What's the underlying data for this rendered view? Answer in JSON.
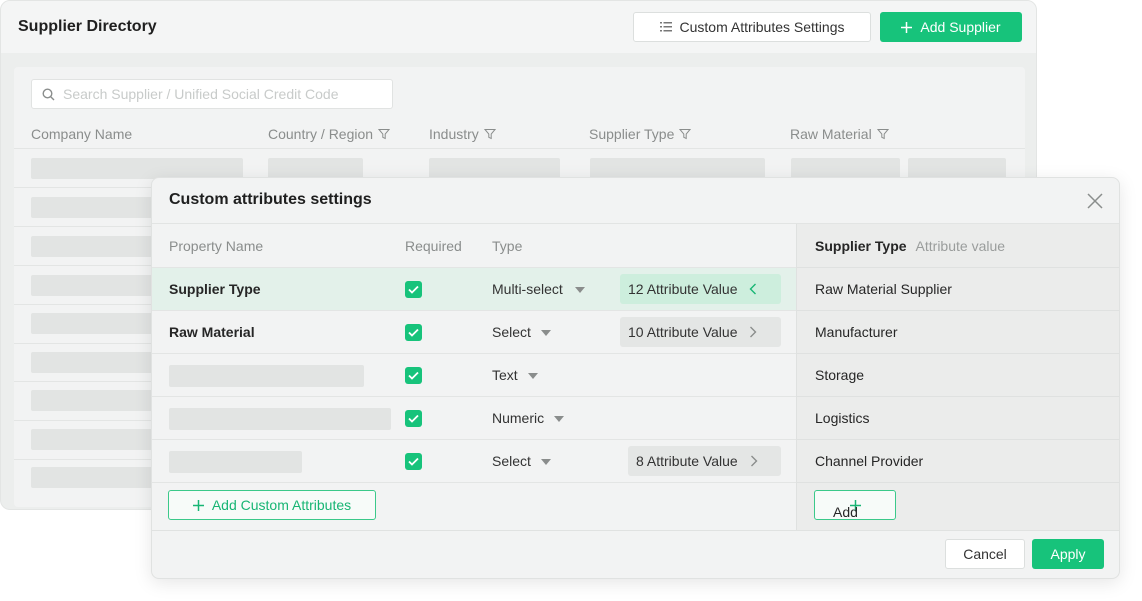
{
  "app": {
    "title": "Supplier Directory",
    "custom_settings_label": "Custom Attributes Settings",
    "add_supplier_label": "Add Supplier",
    "accent_color": "#17c37b"
  },
  "search": {
    "placeholder": "Search Supplier / Unified Social Credit Code",
    "value": ""
  },
  "table": {
    "columns": [
      "Company Name",
      "Country / Region",
      "Industry",
      "Supplier Type",
      "Raw Material"
    ]
  },
  "modal": {
    "title": "Custom attributes settings",
    "headers": {
      "property_name": "Property Name",
      "required": "Required",
      "type": "Type"
    },
    "rows": [
      {
        "name": "Supplier Type",
        "required": true,
        "type": "Multi-select",
        "attr_value": "12 Attribute Value",
        "active": true
      },
      {
        "name": "Raw Material",
        "required": true,
        "type": "Select",
        "attr_value": "10 Attribute Value",
        "active": false
      },
      {
        "name": "",
        "required": true,
        "type": "Text",
        "attr_value": "",
        "active": false
      },
      {
        "name": "",
        "required": true,
        "type": "Numeric",
        "attr_value": "",
        "active": false
      },
      {
        "name": "",
        "required": true,
        "type": "Select",
        "attr_value": "8 Attribute Value",
        "active": false
      }
    ],
    "add_custom_label": "Add Custom Attributes",
    "right": {
      "heading": "Supplier Type",
      "subheading": "Attribute value",
      "values": [
        "Raw Material Supplier",
        "Manufacturer",
        "Storage",
        "Logistics",
        "Channel Provider"
      ],
      "add_label": "Add"
    },
    "cancel_label": "Cancel",
    "apply_label": "Apply"
  }
}
